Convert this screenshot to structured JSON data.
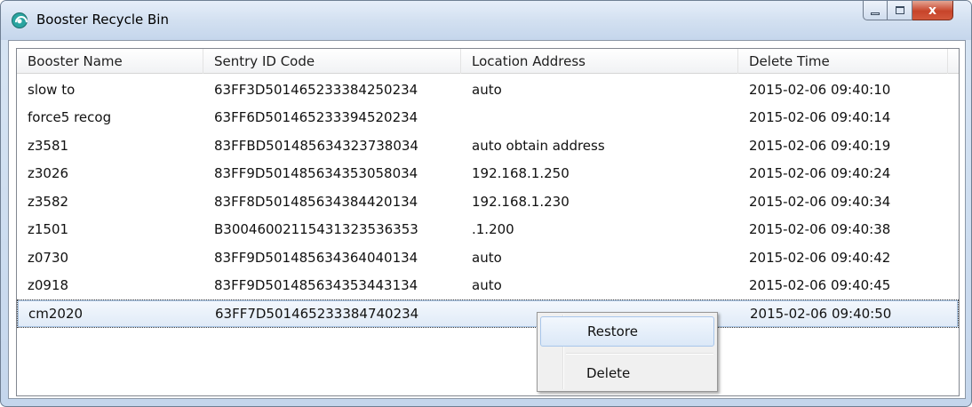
{
  "window": {
    "title": "Booster Recycle Bin",
    "close_glyph": "x"
  },
  "table": {
    "columns": [
      "Booster Name",
      "Sentry ID Code",
      "Location Address",
      "Delete Time"
    ],
    "rows": [
      {
        "name": "slow to",
        "id": "63FF3D501465233384250234",
        "location": "auto",
        "time": "2015-02-06 09:40:10"
      },
      {
        "name": "force5 recog",
        "id": "63FF6D501465233394520234",
        "location": "",
        "time": "2015-02-06 09:40:14"
      },
      {
        "name": "z3581",
        "id": "83FFBD501485634323738034",
        "location": "auto obtain address",
        "time": "2015-02-06 09:40:19"
      },
      {
        "name": "z3026",
        "id": "83FF9D501485634353058034",
        "location": "192.168.1.250",
        "time": "2015-02-06 09:40:24"
      },
      {
        "name": "z3582",
        "id": "83FF8D501485634384420134",
        "location": "192.168.1.230",
        "time": "2015-02-06 09:40:34"
      },
      {
        "name": "z1501",
        "id": "B30046002115431323536353",
        "location": ".1.200",
        "time": "2015-02-06 09:40:38"
      },
      {
        "name": "z0730",
        "id": "83FF9D501485634364040134",
        "location": "auto",
        "time": "2015-02-06 09:40:42"
      },
      {
        "name": "z0918",
        "id": "83FF9D501485634353443134",
        "location": "auto",
        "time": "2015-02-06 09:40:45"
      },
      {
        "name": "cm2020",
        "id": "63FF7D501465233384740234",
        "location": "",
        "time": "2015-02-06 09:40:50"
      }
    ],
    "selected_row": 8
  },
  "context_menu": {
    "items": [
      "Restore",
      "Delete"
    ],
    "highlighted": "Restore"
  },
  "icons": {
    "app": "wifi-booster-icon",
    "minimize": "minimize-icon",
    "maximize": "maximize-icon",
    "close": "close-icon"
  }
}
